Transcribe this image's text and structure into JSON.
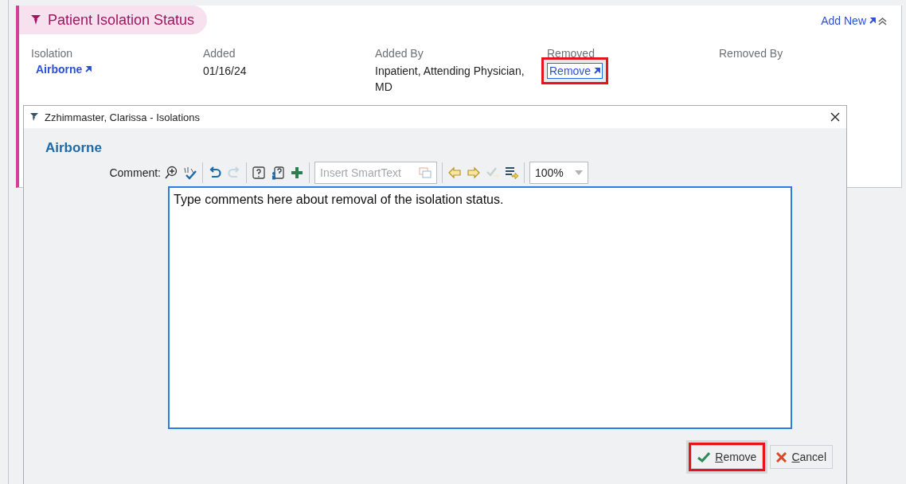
{
  "panel": {
    "title": "Patient Isolation Status",
    "add_new": "Add New",
    "columns": [
      {
        "label": "Isolation"
      },
      {
        "label": "Added"
      },
      {
        "label": "Added By"
      },
      {
        "label": "Removed"
      },
      {
        "label": "Removed By"
      }
    ],
    "rows": [
      {
        "cells": [
          {
            "kind": "link",
            "text": "Airborne",
            "highlighted": false
          },
          {
            "kind": "text",
            "text": "01/16/24"
          },
          {
            "kind": "text",
            "text": "Inpatient, Attending Physician, MD"
          },
          {
            "kind": "link",
            "text": "Remove",
            "highlighted": true
          }
        ]
      }
    ]
  },
  "dialog": {
    "title": "Zzhimmaster, Clarissa - Isolations",
    "heading": "Airborne",
    "comment_label": "Comment:",
    "smarttext_placeholder": "Insert SmartText",
    "zoom": "100%",
    "comment": "Type comments here about removal of the isolation status.",
    "buttons": [
      {
        "kind": "confirm",
        "label": "Remove",
        "highlighted": true
      },
      {
        "kind": "cancel",
        "label": "Cancel",
        "highlighted": false
      }
    ]
  }
}
